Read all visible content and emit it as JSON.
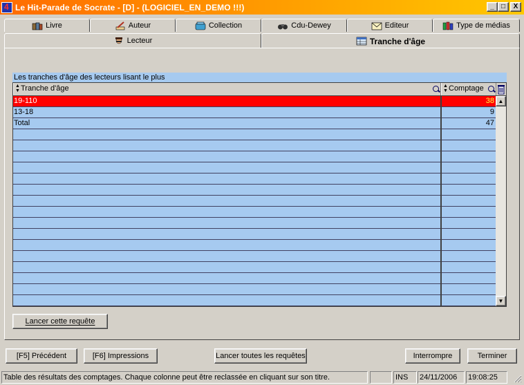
{
  "window": {
    "title": "Le Hit-Parade de Socrate - [D] - (LOGICIEL_EN_DEMO !!!)",
    "minimize_label": "_",
    "maximize_label": "□",
    "close_label": "X"
  },
  "tabs_row1": [
    {
      "label": "Livre",
      "icon": "books-icon"
    },
    {
      "label": "Auteur",
      "icon": "pen-icon"
    },
    {
      "label": "Collection",
      "icon": "box-icon"
    },
    {
      "label": "Cdu-Dewey",
      "icon": "binoculars-icon"
    },
    {
      "label": "Editeur",
      "icon": "envelope-icon"
    },
    {
      "label": "Type de médias",
      "icon": "media-icon"
    }
  ],
  "tabs_row2": [
    {
      "label": "Lecteur",
      "icon": "reader-icon"
    },
    {
      "label": "Tranche d'âge",
      "icon": "table-icon",
      "active": true
    }
  ],
  "grid": {
    "caption": "Les tranches d'âge des lecteurs lisant le plus",
    "columns": [
      "Tranche d'âge",
      "Comptage"
    ],
    "rows": [
      {
        "tranche": "19-110",
        "comptage": "38",
        "selected": true
      },
      {
        "tranche": "13-18",
        "comptage": "9"
      },
      {
        "tranche": "Total",
        "comptage": "47"
      }
    ],
    "empty_rows": 16
  },
  "buttons": {
    "run_query": "Lancer cette requête",
    "previous": "[F5] Précédent",
    "print": "[F6] Impressions",
    "run_all": "Lancer toutes les requêtes",
    "interrupt": "Interrompre",
    "finish": "Terminer"
  },
  "status": {
    "message": "Table des résultats des comptages. Chaque colonne peut être reclassée en cliquant sur son titre.",
    "mode": "INS",
    "date": "24/11/2006",
    "time": "19:08:25"
  },
  "colors": {
    "selected_row": "#ff0000",
    "grid_background": "#a6caf0",
    "title_gradient_start": "#ff6b00",
    "title_gradient_end": "#ffc800"
  }
}
